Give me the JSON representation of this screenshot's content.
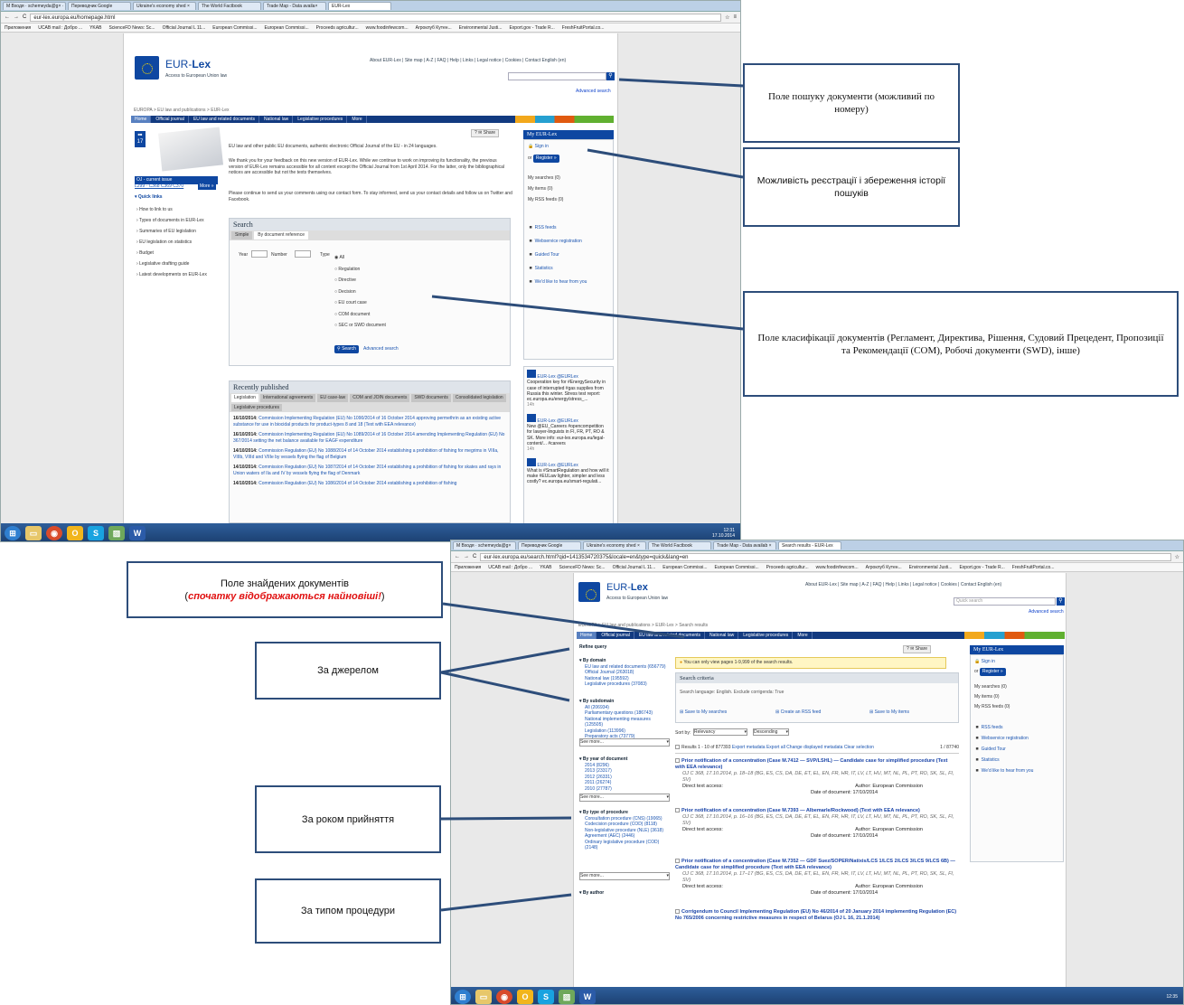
{
  "browser1": {
    "tabs": [
      "M Входя · schemeyda@g× ·",
      "Переводчик Google",
      "Ukraine's economy shed ×",
      "The World Factbook",
      "Trade Map - Data availa×",
      "EUR-Lex"
    ],
    "url": "eur-lex.europa.eu/homepage.html",
    "bookmarks": [
      "Приложения",
      "UCAB mail : Добро ...",
      "YKAB",
      "ScienceFD News: Sc...",
      "Official Journal L 11...",
      "European Commissi...",
      "European Commissi...",
      "Proceeds agricultur...",
      "www.foodinfewcom...",
      "Агроклуб Кутен...",
      "Environmental Justi...",
      "Export.gov - Trade R...",
      "FreshFruitPortal.co..."
    ]
  },
  "eurlex1": {
    "brand_a": "EUR-",
    "brand_b": "Lex",
    "brand_sub": "Access to European Union law",
    "top_links": "About EUR-Lex | Site map | A-Z | FAQ | Help | Links | Legal notice | Cookies | Contact   English (en)",
    "advanced_search": "Advanced search",
    "breadcrumb": "EUROPA > EU law and publications > EUR-Lex",
    "nav": [
      "Home",
      "Official journal",
      "EU law and related documents",
      "National law",
      "Legislative procedures",
      "More"
    ],
    "calendar": "17",
    "oj_title": "OJ - current issue",
    "oj_links": "L299 · C368 C369 C370",
    "oj_more": "More »",
    "quick_links_title": "Quick links",
    "quick_links": [
      "How to link to us",
      "Types of documents in EUR-Lex",
      "Summaries of EU legislation",
      "EU legislation on statistics",
      "Budget",
      "Legislative drafting guide",
      "Latest developments on EUR-Lex"
    ],
    "share": "Share",
    "intro_1": "EU law and other public EU documents, authentic electronic Official Journal of the EU - in 24 languages.",
    "intro_2": "We thank you for your feedback on this new version of EUR-Lex. While we continue to work on improving its functionality, the previous version of EUR-Lex remains accessible for all content except the Official Journal from 1st April 2014. For the latter, only the bibliographical notices are accessible but not the texts themselves.",
    "intro_3": "Please continue to send us your comments using our contact form. To stay informed, send us your contact details and follow us on Twitter and Facebook.",
    "search_title": "Search",
    "search_tabs": [
      "Simple",
      "By document reference"
    ],
    "year_label": "Year",
    "number_label": "Number",
    "type_label": "Type",
    "types": [
      "All",
      "Regulation",
      "Directive",
      "Decision",
      "EU court case",
      "COM document",
      "SEC or SWD document"
    ],
    "search_button": "Search",
    "advanced_link": "Advanced search",
    "recent_title": "Recently published",
    "recent_tabs": [
      "Legislation",
      "International agreements",
      "EU case-law",
      "COM and JOIN documents",
      "SWD documents",
      "Consolidated legislation",
      "Legislative procedures"
    ],
    "recent": [
      {
        "date": "16/10/2014:",
        "text": "Commission Implementing Regulation (EU) No 1090/2014 of 16 October 2014 approving permethrin as an existing active substance for use in biocidal products for product-types 8 and 18 (Text with EEA relevance)"
      },
      {
        "date": "16/10/2014:",
        "text": "Commission Implementing Regulation (EU) No 1089/2014 of 16 October 2014 amending Implementing Regulation (EU) No 367/2014 setting the net balance available for EAGF expenditure"
      },
      {
        "date": "14/10/2014:",
        "text": "Commission Regulation (EU) No 1088/2014 of 14 October 2014 establishing a prohibition of fishing for megrims in VIIIa, VIIIb, VIIId and VIIIe by vessels flying the flag of Belgium"
      },
      {
        "date": "14/10/2014:",
        "text": "Commission Regulation (EU) No 1087/2014 of 14 October 2014 establishing a prohibition of fishing for skates and rays in Union waters of IIa and IV by vessels flying the flag of Denmark"
      },
      {
        "date": "14/10/2014:",
        "text": "Commission Regulation (EU) No 1086/2014 of 14 October 2014 establishing a prohibition of fishing"
      }
    ],
    "my_eurlex": "My EUR-Lex",
    "sign_in": "Sign in",
    "or": "or",
    "register": "Register »",
    "my_items": [
      "My searches (0)",
      "My items (0)",
      "My RSS feeds (0)"
    ],
    "side_links": [
      "RSS feeds",
      "Webservice registration",
      "Guided Tour",
      "Statistics",
      "We'd like to hear from you"
    ],
    "tweets": [
      {
        "author": "EUR-Lex @EURLex",
        "text": "Cooperation key for #EnergySecurity in case of interrupted #gas supplies from Russia this winter. Stress test report: ec.europa.eu/energy/stress_...",
        "time": "14h"
      },
      {
        "author": "EUR-Lex @EURLex",
        "text": "New @EU_Careers #opencompetition for lawyer-linguists in FI, FR, PT, RO & SK. More info: eur-lex.europa.eu/legal-content/... #careers",
        "time": "14h"
      },
      {
        "author": "EUR-Lex @EURLex",
        "text": "What is #SmartRegulation and how will it make #EULaw lighter, simpler and less costly? ec.europa.eu/smart-regulati...",
        "time": ""
      }
    ],
    "clock": "12:31",
    "clock_date": "17.10.2014"
  },
  "browser2": {
    "tabs": [
      "M Входя · schemeyda@g×",
      "Переводчик Google",
      "Ukraine's economy shed ×",
      "The World Factbook",
      "Trade Map - Data availab ×",
      "Search results - EUR-Lex"
    ],
    "url": "eur-lex.europa.eu/search.html?qid=1413534720375&locale=en&type=quick&lang=en",
    "bookmarks": [
      "Приложения",
      "UCAB mail : Добро ...",
      "YKAB",
      "ScienceFD News: Sc...",
      "Official Journal L 11...",
      "European Commissi...",
      "European Commissi...",
      "Proceeds agricultur...",
      "www.foodinfewcom...",
      "Агроклуб Кутен...",
      "Environmental Justi...",
      "Export.gov - Trade R...",
      "FreshFruitPortal.co..."
    ]
  },
  "eurlex2": {
    "quick_search_placeholder": "Quick search",
    "advanced_search": "Advanced search",
    "breadcrumb": "EUROPA > EU law and publications > EUR-Lex > Search results",
    "nav": [
      "Home",
      "Official journal",
      "EU law and related documents",
      "National law",
      "Legislative procedures",
      "More"
    ],
    "refine": "Refine query",
    "by_domain": "By domain",
    "domain_items": [
      "EU law and related documents (656779)",
      "Official Journal (263018)",
      "National law (195592)",
      "Legislative procedures (37083)"
    ],
    "by_subdomain": "By subdomain",
    "subdomain_items": [
      "All (206934)",
      "Parliamentary questions (186743)",
      "National implementing measures (125505)",
      "Legislation (113996)",
      "Preparatory acts (73779)"
    ],
    "see_more": "See more...",
    "by_year": "By year of document",
    "year_items": [
      "2014 (8296)",
      "2013 (23317)",
      "2012 (26331)",
      "2011 (26274)",
      "2010 (27787)"
    ],
    "by_procedure": "By type of procedure",
    "procedure_items": [
      "Consultation procedure (CNS) (19065)",
      "Codecision procedure (COD) (8118)",
      "Non-legislative procedure (NLE) (3618)",
      "Agreement (AEC) (2446)",
      "Ordinary legislative procedure (COD) (2148)"
    ],
    "by_author": "By author",
    "warning": "You can only view pages 1-9,999 of the search results.",
    "criteria_title": "Search criteria",
    "criteria_text": "Search language: English. Exclude corrigenda: True",
    "save_search": "Save to My searches",
    "create_rss": "Create an RSS feed",
    "save_items": "Save to My items",
    "sort_by": "Sort by:",
    "sort_value": "Relevancy",
    "order_value": "Descending",
    "results_count": "Results 1 - 10 of 877393",
    "results_links": "Export metadata  Export all  Change displayed metadata  Clear selection",
    "pager": "1 / 87740",
    "results": [
      {
        "title": "Prior notification of a concentration (Case M.7412 — SVP/LSHL) — Candidate case for simplified procedure (Text with EEA relevance)",
        "meta": "OJ C 368, 17.10.2014, p. 18–18 (BG, ES, CS, DA, DE, ET, EL, EN, FR, HR, IT, LV, LT, HU, MT, NL, PL, PT, RO, SK, SL, FI, SV)",
        "author": "Author: European Commission",
        "date": "Date of document: 17/10/2014"
      },
      {
        "title": "Prior notification of a concentration (Case M.7393 — Albemarle/Rockwood) (Text with EEA relevance)",
        "meta": "OJ C 368, 17.10.2014, p. 16–16 (BG, ES, CS, DA, DE, ET, EL, EN, FR, HR, IT, LV, LT, HU, MT, NL, PL, PT, RO, SK, SL, FI, SV)",
        "author": "Author: European Commission",
        "date": "Date of document: 17/10/2014"
      },
      {
        "title": "Prior notification of a concentration (Case M.7352 — GDF Suez/SOPER/Natixis/LCS 1/LCS 2/LCS 3/LCS 9/LCS 6B) — Candidate case for simplified procedure (Text with EEA relevance)",
        "meta": "OJ C 368, 17.10.2014, p. 17–17 (BG, ES, CS, DA, DE, ET, EL, EN, FR, HR, IT, LV, LT, HU, MT, NL, PL, PT, RO, SK, SL, FI, SV)",
        "author": "Author: European Commission",
        "date": "Date of document: 17/10/2014"
      },
      {
        "title": "Corrigendum to Council Implementing Regulation (EU) No 46/2014 of 20 January 2014 implementing Regulation (EC) No 765/2006 concerning restrictive measures in respect of Belarus (OJ L 16, 21.1.2014)",
        "meta": "",
        "author": "",
        "date": ""
      }
    ],
    "direct_access": "Direct text access:",
    "clock": "12:35"
  },
  "callouts": {
    "search_field": "Поле пошуку документи (можливий по номеру)",
    "registration": "Можливість реєстрації і збереження історії пошуків",
    "classification": "Поле класифікації документів (Регламент, Директива, Рішення, Судовий Прецедент, Пропозиції та Рекомендації (COM), Робочі документи (SWD), інше)",
    "found_docs_a": "Поле знайдених документів",
    "found_docs_b": "спочатку відображаються найновіші!",
    "by_source": "За джерелом",
    "by_year": "За роком прийняття",
    "by_procedure": "За типом процедури"
  },
  "colors": {
    "eu_blue": "#0e47a1",
    "callout_border": "#2d4d7a",
    "highlight_red": "#e01010"
  }
}
